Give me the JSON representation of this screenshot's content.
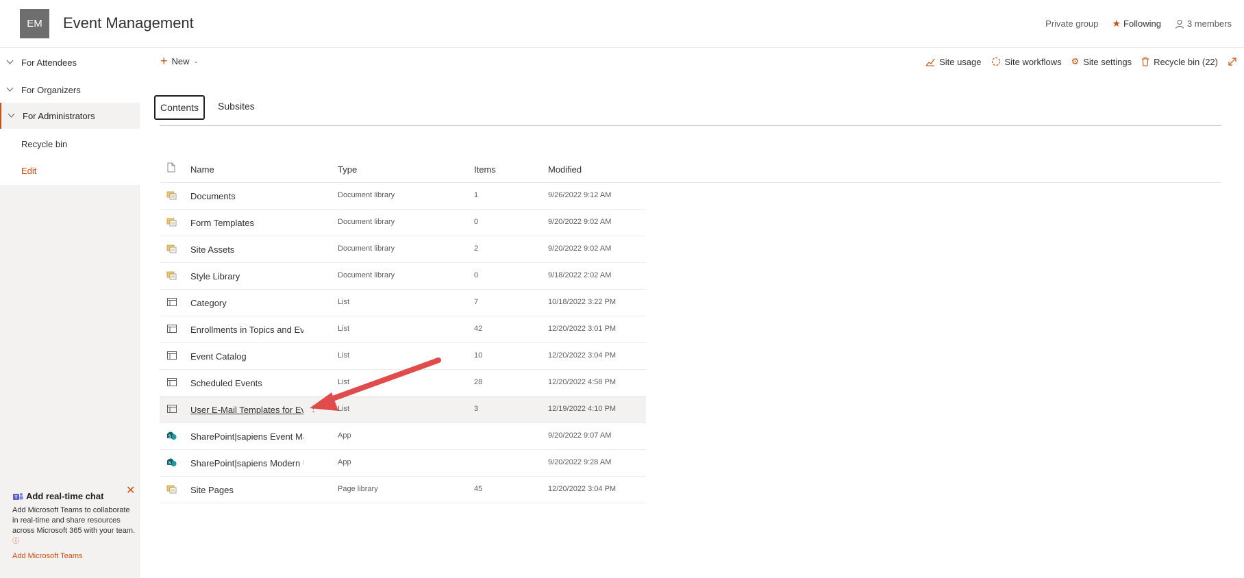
{
  "header": {
    "avatar_initials": "EM",
    "site_title": "Event Management",
    "privacy": "Private group",
    "following": "Following",
    "members": "3 members"
  },
  "leftnav": {
    "items": [
      {
        "label": "For Attendees",
        "chevron": true
      },
      {
        "label": "For Organizers",
        "chevron": true
      },
      {
        "label": "For Administrators",
        "chevron": true,
        "selected": true
      },
      {
        "label": "Recycle bin"
      },
      {
        "label": "Edit"
      }
    ]
  },
  "teams_promo": {
    "title": "Add real-time chat",
    "body": "Add Microsoft Teams to collaborate in real-time and share resources across Microsoft 365 with your team.",
    "link": "Add Microsoft Teams"
  },
  "commandbar": {
    "new_label": "New",
    "site_usage": "Site usage",
    "site_workflows": "Site workflows",
    "site_settings": "Site settings",
    "recycle_bin": "Recycle bin (22)"
  },
  "tabs": [
    "Contents",
    "Subsites"
  ],
  "table": {
    "headers": {
      "name": "Name",
      "type": "Type",
      "items": "Items",
      "modified": "Modified"
    },
    "rows": [
      {
        "icon": "library-icon",
        "name": "Documents",
        "type": "Document library",
        "items": "1",
        "modified": "9/26/2022 9:12 AM"
      },
      {
        "icon": "library-icon",
        "name": "Form Templates",
        "type": "Document library",
        "items": "0",
        "modified": "9/20/2022 9:02 AM"
      },
      {
        "icon": "library-icon",
        "name": "Site Assets",
        "type": "Document library",
        "items": "2",
        "modified": "9/20/2022 9:02 AM"
      },
      {
        "icon": "library-icon",
        "name": "Style Library",
        "type": "Document library",
        "items": "0",
        "modified": "9/18/2022 2:02 AM"
      },
      {
        "icon": "list-icon",
        "name": "Category",
        "type": "List",
        "items": "7",
        "modified": "10/18/2022 3:22 PM"
      },
      {
        "icon": "list-icon",
        "name": "Enrollments in Topics and Events",
        "type": "List",
        "items": "42",
        "modified": "12/20/2022 3:01 PM"
      },
      {
        "icon": "list-icon",
        "name": "Event Catalog",
        "type": "List",
        "items": "10",
        "modified": "12/20/2022 3:04 PM"
      },
      {
        "icon": "list-icon",
        "name": "Scheduled Events",
        "type": "List",
        "items": "28",
        "modified": "12/20/2022 4:58 PM"
      },
      {
        "icon": "list-icon",
        "name": "User E-Mail Templates for Events",
        "type": "List",
        "items": "3",
        "modified": "12/19/2022 4:10 PM",
        "hover": true
      },
      {
        "icon": "app-icon",
        "name": "SharePoint|sapiens Event Management",
        "type": "App",
        "items": "",
        "modified": "9/20/2022 9:07 AM"
      },
      {
        "icon": "app-icon",
        "name": "SharePoint|sapiens Modern UI",
        "type": "App",
        "items": "",
        "modified": "9/20/2022 9:28 AM"
      },
      {
        "icon": "library-icon",
        "name": "Site Pages",
        "type": "Page library",
        "items": "45",
        "modified": "12/20/2022 3:04 PM"
      }
    ]
  },
  "colors": {
    "accent": "#ca5010",
    "arrow": "#e04b4b"
  }
}
